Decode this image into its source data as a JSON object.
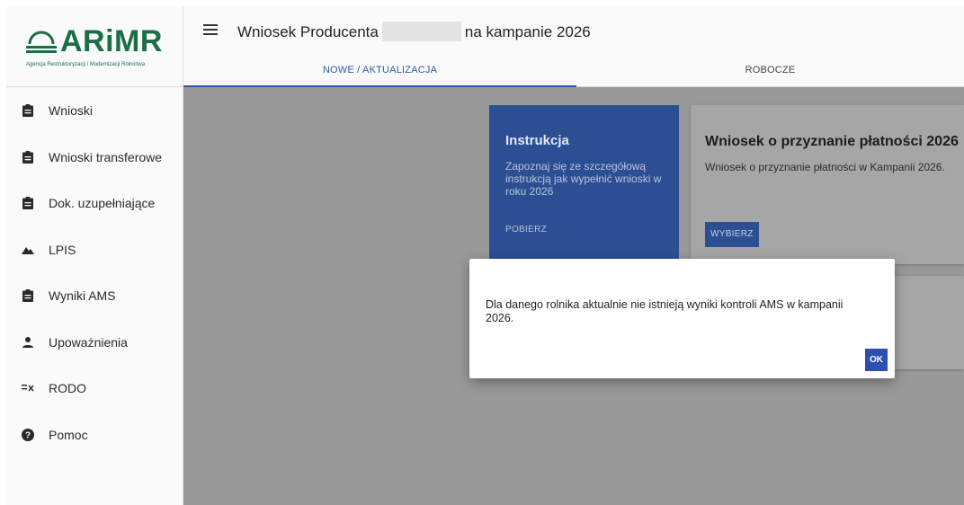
{
  "logo": {
    "name": "ARiMR",
    "subtitle": "Agencja Restrukturyzacji i Modernizacji Rolnictwa"
  },
  "header": {
    "title_prefix": "Wniosek Producenta",
    "title_suffix": "na kampanie 2026",
    "menu_icon": "hamburger-menu-icon"
  },
  "tabs": [
    {
      "label": "NOWE / AKTUALIZACJA",
      "active": true
    },
    {
      "label": "ROBOCZE",
      "active": false
    }
  ],
  "sidebar": {
    "items": [
      {
        "label": "Wnioski",
        "icon": "clipboard-icon"
      },
      {
        "label": "Wnioski transferowe",
        "icon": "clipboard-icon"
      },
      {
        "label": "Dok. uzupełniające",
        "icon": "clipboard-icon"
      },
      {
        "label": "LPIS",
        "icon": "terrain-icon"
      },
      {
        "label": "Wyniki AMS",
        "icon": "clipboard-icon"
      },
      {
        "label": "Upoważnienia",
        "icon": "person-icon"
      },
      {
        "label": "RODO",
        "icon": "list-x-icon"
      },
      {
        "label": "Pomoc",
        "icon": "help-icon"
      }
    ]
  },
  "cards": {
    "instruction": {
      "title": "Instrukcja",
      "description": "Zapoznaj się ze szczegółową instrukcją jak wypełnić wnioski w roku 2026",
      "button": "POBIERZ"
    },
    "payment": {
      "title": "Wniosek o przyznanie płatności 2026",
      "description": "Wniosek o przyznanie płatności w Kampanii 2026.",
      "button": "WYBIERZ"
    }
  },
  "dialog": {
    "message": "Dla danego rolnika aktualnie nie istnieją wyniki kontroli AMS w kampanii 2026.",
    "ok_label": "OK"
  },
  "colors": {
    "brand_green": "#1c6e45",
    "primary_blue": "#2c4f93",
    "tab_active": "#2b5aa3",
    "overlay": "#999999"
  }
}
